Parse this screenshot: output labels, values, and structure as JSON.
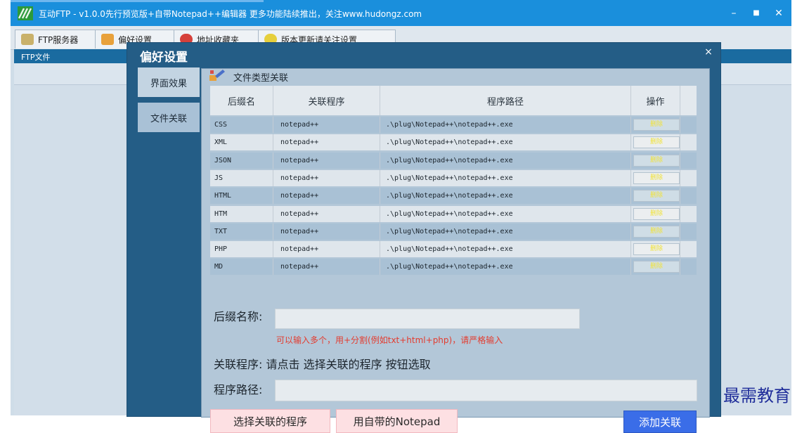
{
  "window": {
    "title": "互动FTP  -  v1.0.0先行预览版+自带Notepad++编辑器   更多功能陆续推出，关注www.hudongz.com",
    "minimize": "–",
    "maximize": "■",
    "close": "✕"
  },
  "toolbar": {
    "tabs": [
      "FTP服务器",
      "偏好设置",
      "地址收藏夹",
      "版本更新请关注设置"
    ]
  },
  "left_pane": {
    "label": "FTP文件"
  },
  "dialog": {
    "title": "偏好设置",
    "close": "×",
    "tabs": [
      "界面效果",
      "文件关联"
    ],
    "group_title": "文件类型关联",
    "table": {
      "headers": [
        "后缀名",
        "关联程序",
        "程序路径",
        "操作"
      ],
      "rows": [
        [
          "CSS",
          "notepad++",
          ".\\plug\\Notepad++\\notepad++.exe"
        ],
        [
          "XML",
          "notepad++",
          ".\\plug\\Notepad++\\notepad++.exe"
        ],
        [
          "JSON",
          "notepad++",
          ".\\plug\\Notepad++\\notepad++.exe"
        ],
        [
          "JS",
          "notepad++",
          ".\\plug\\Notepad++\\notepad++.exe"
        ],
        [
          "HTML",
          "notepad++",
          ".\\plug\\Notepad++\\notepad++.exe"
        ],
        [
          "HTM",
          "notepad++",
          ".\\plug\\Notepad++\\notepad++.exe"
        ],
        [
          "TXT",
          "notepad++",
          ".\\plug\\Notepad++\\notepad++.exe"
        ],
        [
          "PHP",
          "notepad++",
          ".\\plug\\Notepad++\\notepad++.exe"
        ],
        [
          "MD",
          "notepad++",
          ".\\plug\\Notepad++\\notepad++.exe"
        ]
      ],
      "delete_label": "删除"
    },
    "form": {
      "suffix_label": "后缀名称:",
      "suffix_value": "",
      "hint": "可以输入多个，用+分割(例如txt+html+php)，请严格输入",
      "program_label": "关联程序: 请点击 选择关联的程序 按钮选取",
      "path_label": "程序路径:",
      "path_value": ""
    },
    "buttons": {
      "choose": "选择关联的程序",
      "builtin": "用自带的Notepad",
      "add": "添加关联"
    }
  },
  "watermark": "最需教育",
  "colors": {
    "titlebar": "#1a8fdc",
    "dialog": "#245d86",
    "add_button": "#3a6de8",
    "hint": "#e33c2f"
  }
}
